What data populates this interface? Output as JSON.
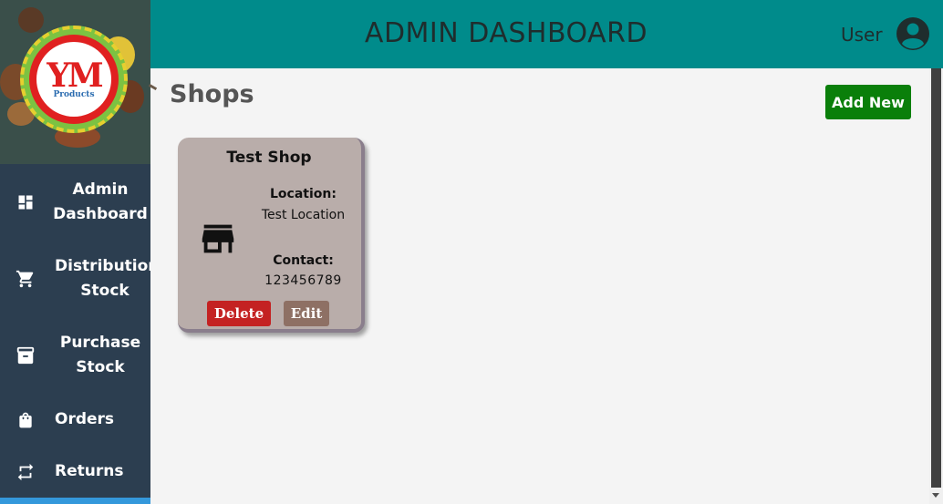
{
  "header": {
    "title": "ADMIN DASHBOARD",
    "user_label": "User"
  },
  "logo": {
    "text": "YM",
    "sub": "Products"
  },
  "sidebar": {
    "items": [
      {
        "label": "Admin\nDashboard",
        "icon": "dashboard-icon"
      },
      {
        "label": "Distribution\nStock",
        "icon": "cart-icon"
      },
      {
        "label": "Purchase\nStock",
        "icon": "archive-icon"
      },
      {
        "label": "Orders",
        "icon": "bag-icon"
      },
      {
        "label": "Returns",
        "icon": "swap-icon"
      }
    ]
  },
  "main": {
    "title": "Shops",
    "add_button": "Add New",
    "cards": [
      {
        "name": "Test Shop",
        "location_label": "Location:",
        "location_value": "Test Location",
        "contact_label": "Contact:",
        "contact_value": "123456789",
        "delete_label": "Delete",
        "edit_label": "Edit",
        "icon": "store-icon"
      }
    ]
  },
  "colors": {
    "header": "#008b8b",
    "sidebar": "#2c3e50",
    "card": "#b9adaa",
    "add": "#0a7f0a",
    "delete": "#c42222",
    "edit": "#8e7064"
  }
}
